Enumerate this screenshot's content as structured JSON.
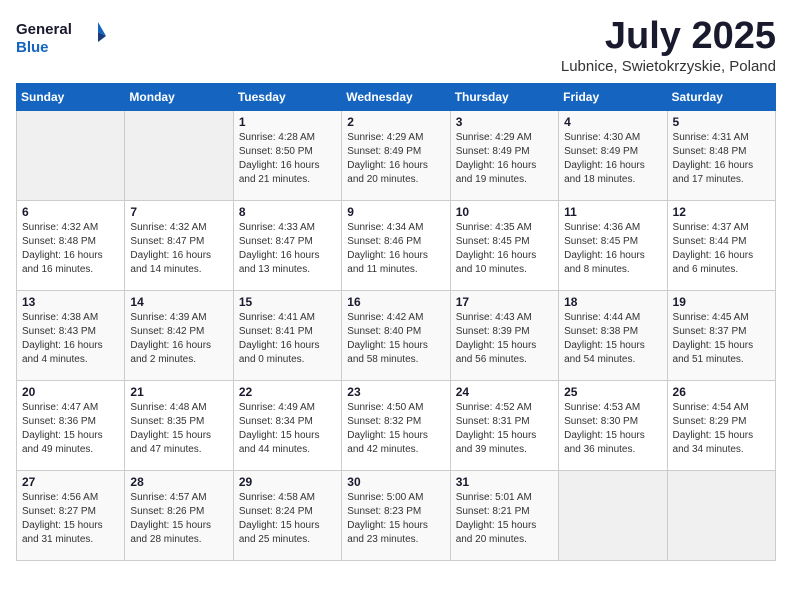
{
  "header": {
    "logo_general": "General",
    "logo_blue": "Blue",
    "month_title": "July 2025",
    "location": "Lubnice, Swietokrzyskie, Poland"
  },
  "days_of_week": [
    "Sunday",
    "Monday",
    "Tuesday",
    "Wednesday",
    "Thursday",
    "Friday",
    "Saturday"
  ],
  "weeks": [
    [
      {
        "day": "",
        "sunrise": "",
        "sunset": "",
        "daylight": ""
      },
      {
        "day": "",
        "sunrise": "",
        "sunset": "",
        "daylight": ""
      },
      {
        "day": "1",
        "sunrise": "Sunrise: 4:28 AM",
        "sunset": "Sunset: 8:50 PM",
        "daylight": "Daylight: 16 hours and 21 minutes."
      },
      {
        "day": "2",
        "sunrise": "Sunrise: 4:29 AM",
        "sunset": "Sunset: 8:49 PM",
        "daylight": "Daylight: 16 hours and 20 minutes."
      },
      {
        "day": "3",
        "sunrise": "Sunrise: 4:29 AM",
        "sunset": "Sunset: 8:49 PM",
        "daylight": "Daylight: 16 hours and 19 minutes."
      },
      {
        "day": "4",
        "sunrise": "Sunrise: 4:30 AM",
        "sunset": "Sunset: 8:49 PM",
        "daylight": "Daylight: 16 hours and 18 minutes."
      },
      {
        "day": "5",
        "sunrise": "Sunrise: 4:31 AM",
        "sunset": "Sunset: 8:48 PM",
        "daylight": "Daylight: 16 hours and 17 minutes."
      }
    ],
    [
      {
        "day": "6",
        "sunrise": "Sunrise: 4:32 AM",
        "sunset": "Sunset: 8:48 PM",
        "daylight": "Daylight: 16 hours and 16 minutes."
      },
      {
        "day": "7",
        "sunrise": "Sunrise: 4:32 AM",
        "sunset": "Sunset: 8:47 PM",
        "daylight": "Daylight: 16 hours and 14 minutes."
      },
      {
        "day": "8",
        "sunrise": "Sunrise: 4:33 AM",
        "sunset": "Sunset: 8:47 PM",
        "daylight": "Daylight: 16 hours and 13 minutes."
      },
      {
        "day": "9",
        "sunrise": "Sunrise: 4:34 AM",
        "sunset": "Sunset: 8:46 PM",
        "daylight": "Daylight: 16 hours and 11 minutes."
      },
      {
        "day": "10",
        "sunrise": "Sunrise: 4:35 AM",
        "sunset": "Sunset: 8:45 PM",
        "daylight": "Daylight: 16 hours and 10 minutes."
      },
      {
        "day": "11",
        "sunrise": "Sunrise: 4:36 AM",
        "sunset": "Sunset: 8:45 PM",
        "daylight": "Daylight: 16 hours and 8 minutes."
      },
      {
        "day": "12",
        "sunrise": "Sunrise: 4:37 AM",
        "sunset": "Sunset: 8:44 PM",
        "daylight": "Daylight: 16 hours and 6 minutes."
      }
    ],
    [
      {
        "day": "13",
        "sunrise": "Sunrise: 4:38 AM",
        "sunset": "Sunset: 8:43 PM",
        "daylight": "Daylight: 16 hours and 4 minutes."
      },
      {
        "day": "14",
        "sunrise": "Sunrise: 4:39 AM",
        "sunset": "Sunset: 8:42 PM",
        "daylight": "Daylight: 16 hours and 2 minutes."
      },
      {
        "day": "15",
        "sunrise": "Sunrise: 4:41 AM",
        "sunset": "Sunset: 8:41 PM",
        "daylight": "Daylight: 16 hours and 0 minutes."
      },
      {
        "day": "16",
        "sunrise": "Sunrise: 4:42 AM",
        "sunset": "Sunset: 8:40 PM",
        "daylight": "Daylight: 15 hours and 58 minutes."
      },
      {
        "day": "17",
        "sunrise": "Sunrise: 4:43 AM",
        "sunset": "Sunset: 8:39 PM",
        "daylight": "Daylight: 15 hours and 56 minutes."
      },
      {
        "day": "18",
        "sunrise": "Sunrise: 4:44 AM",
        "sunset": "Sunset: 8:38 PM",
        "daylight": "Daylight: 15 hours and 54 minutes."
      },
      {
        "day": "19",
        "sunrise": "Sunrise: 4:45 AM",
        "sunset": "Sunset: 8:37 PM",
        "daylight": "Daylight: 15 hours and 51 minutes."
      }
    ],
    [
      {
        "day": "20",
        "sunrise": "Sunrise: 4:47 AM",
        "sunset": "Sunset: 8:36 PM",
        "daylight": "Daylight: 15 hours and 49 minutes."
      },
      {
        "day": "21",
        "sunrise": "Sunrise: 4:48 AM",
        "sunset": "Sunset: 8:35 PM",
        "daylight": "Daylight: 15 hours and 47 minutes."
      },
      {
        "day": "22",
        "sunrise": "Sunrise: 4:49 AM",
        "sunset": "Sunset: 8:34 PM",
        "daylight": "Daylight: 15 hours and 44 minutes."
      },
      {
        "day": "23",
        "sunrise": "Sunrise: 4:50 AM",
        "sunset": "Sunset: 8:32 PM",
        "daylight": "Daylight: 15 hours and 42 minutes."
      },
      {
        "day": "24",
        "sunrise": "Sunrise: 4:52 AM",
        "sunset": "Sunset: 8:31 PM",
        "daylight": "Daylight: 15 hours and 39 minutes."
      },
      {
        "day": "25",
        "sunrise": "Sunrise: 4:53 AM",
        "sunset": "Sunset: 8:30 PM",
        "daylight": "Daylight: 15 hours and 36 minutes."
      },
      {
        "day": "26",
        "sunrise": "Sunrise: 4:54 AM",
        "sunset": "Sunset: 8:29 PM",
        "daylight": "Daylight: 15 hours and 34 minutes."
      }
    ],
    [
      {
        "day": "27",
        "sunrise": "Sunrise: 4:56 AM",
        "sunset": "Sunset: 8:27 PM",
        "daylight": "Daylight: 15 hours and 31 minutes."
      },
      {
        "day": "28",
        "sunrise": "Sunrise: 4:57 AM",
        "sunset": "Sunset: 8:26 PM",
        "daylight": "Daylight: 15 hours and 28 minutes."
      },
      {
        "day": "29",
        "sunrise": "Sunrise: 4:58 AM",
        "sunset": "Sunset: 8:24 PM",
        "daylight": "Daylight: 15 hours and 25 minutes."
      },
      {
        "day": "30",
        "sunrise": "Sunrise: 5:00 AM",
        "sunset": "Sunset: 8:23 PM",
        "daylight": "Daylight: 15 hours and 23 minutes."
      },
      {
        "day": "31",
        "sunrise": "Sunrise: 5:01 AM",
        "sunset": "Sunset: 8:21 PM",
        "daylight": "Daylight: 15 hours and 20 minutes."
      },
      {
        "day": "",
        "sunrise": "",
        "sunset": "",
        "daylight": ""
      },
      {
        "day": "",
        "sunrise": "",
        "sunset": "",
        "daylight": ""
      }
    ]
  ]
}
